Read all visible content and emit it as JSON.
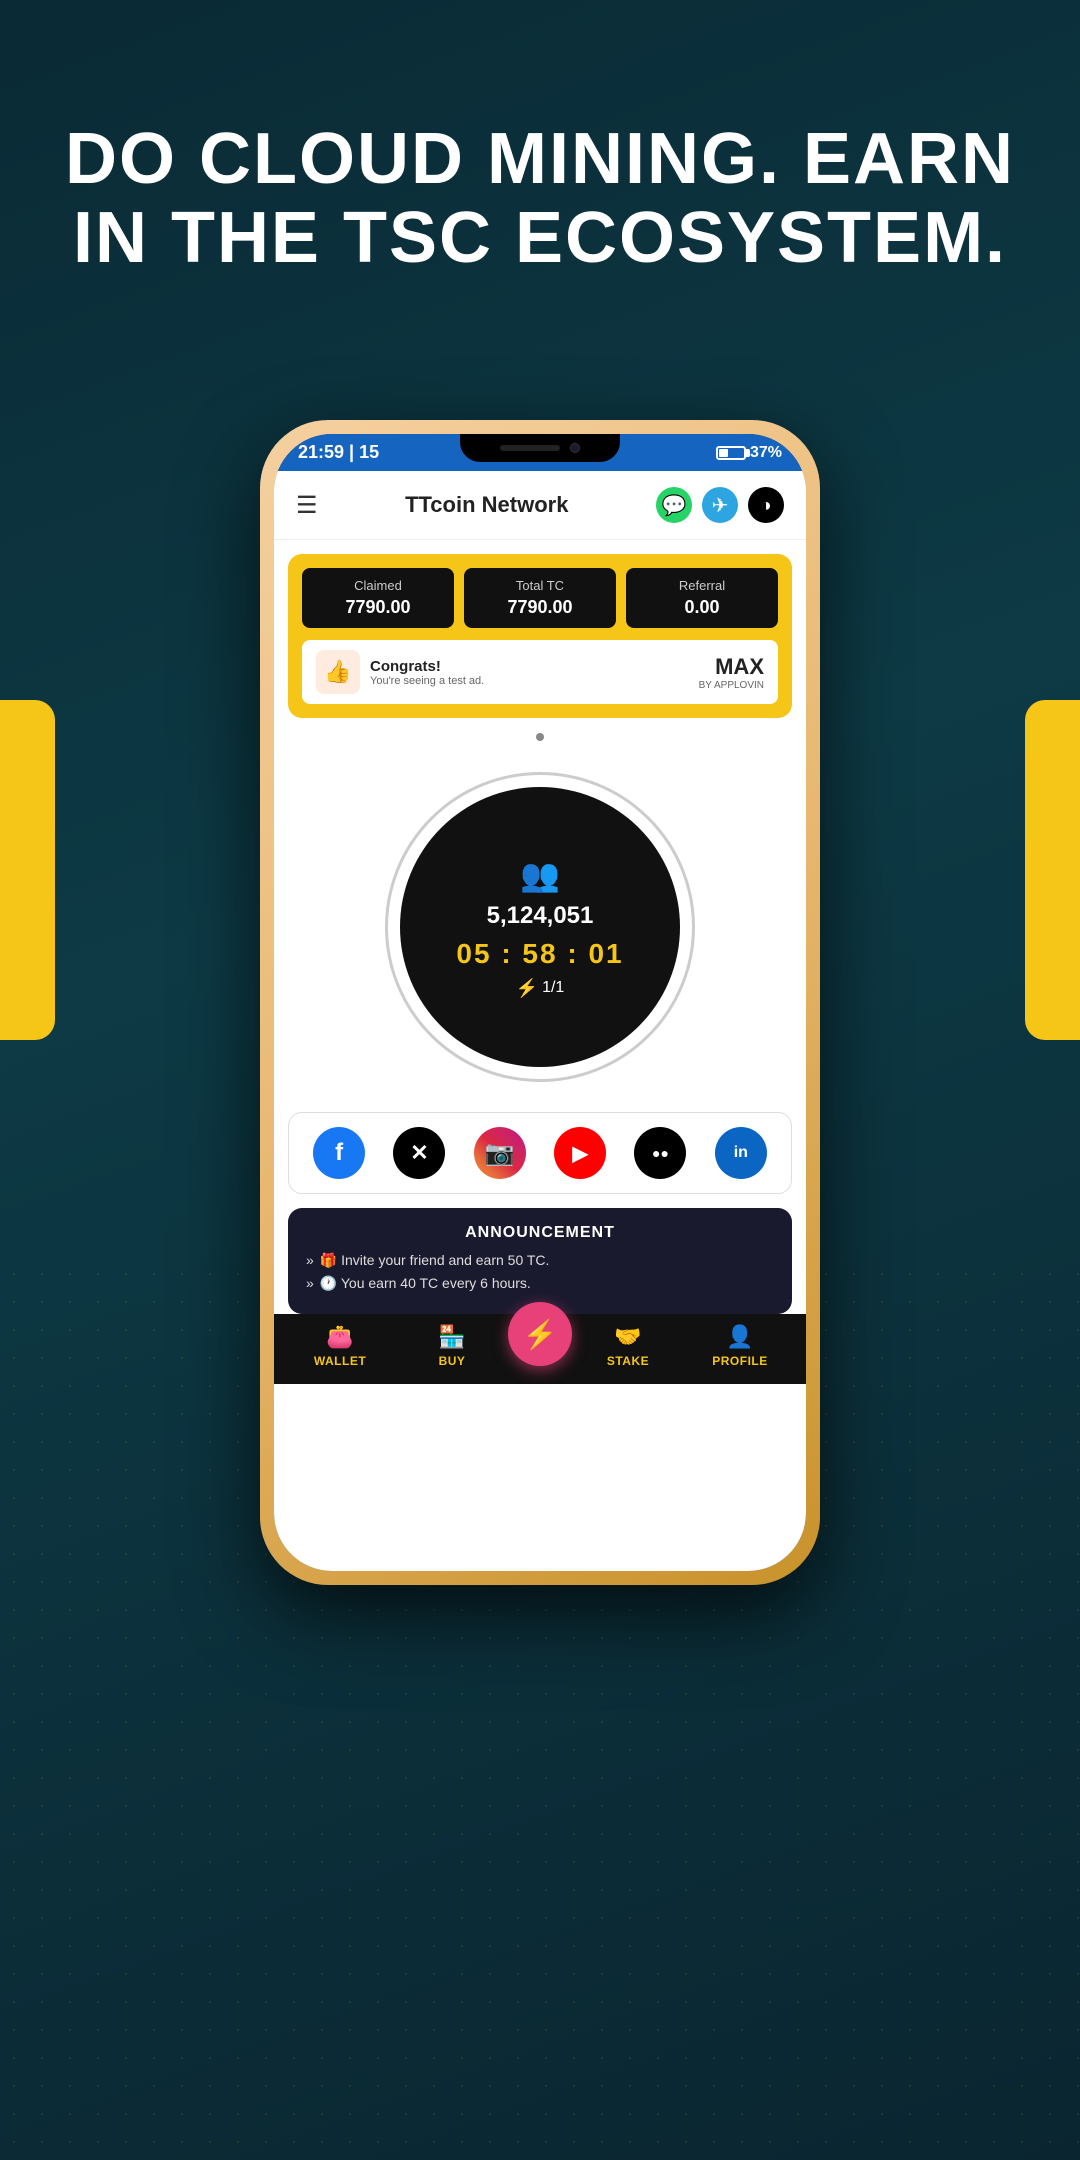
{
  "hero": {
    "line1": "DO CLOUD MINING. EARN",
    "line2": "IN THE TSC ECOSYSTEM."
  },
  "phone": {
    "status_bar": {
      "time": "21:59 | 15",
      "battery_pct": "37%"
    },
    "header": {
      "menu_icon": "☰",
      "title": "TTcoin Network",
      "whatsapp_icon": "💬",
      "telegram_icon": "✈",
      "ttcoin_icon": "◑"
    },
    "stats": {
      "claimed_label": "Claimed",
      "claimed_value": "7790.00",
      "total_tc_label": "Total TC",
      "total_tc_value": "7790.00",
      "referral_label": "Referral",
      "referral_value": "0.00"
    },
    "ad": {
      "congrats": "Congrats!",
      "sub": "You're seeing a test ad.",
      "logo_max": "MAX",
      "logo_by": "BY APPLOVIN"
    },
    "mining": {
      "users_count": "5,124,051",
      "timer": "05 : 58 : 01",
      "boost": "1/1"
    },
    "social": {
      "facebook": "f",
      "x": "𝕏",
      "instagram": "📷",
      "youtube": "▶",
      "medium": "Ⓜ",
      "linkedin": "in"
    },
    "announcement": {
      "title": "ANNOUNCEMENT",
      "item1": "🎁 Invite your friend and earn 50 TC.",
      "item2": "🕐 You earn 40 TC every 6 hours."
    },
    "bottom_nav": {
      "wallet": "WALLET",
      "buy": "BUY",
      "stake": "STAKE",
      "profile": "PROFILE"
    }
  }
}
